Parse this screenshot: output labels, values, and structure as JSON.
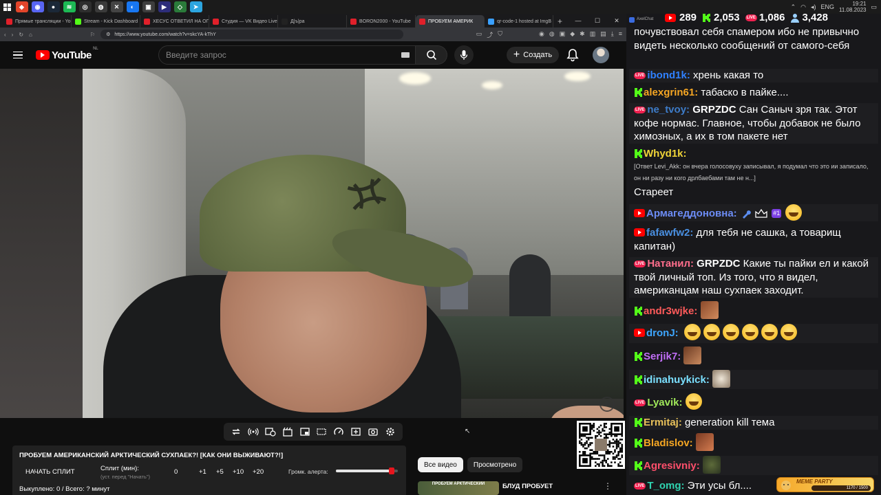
{
  "taskbar": {
    "tray_lang": "ENG",
    "time": "19:21",
    "date": "11.08.2023"
  },
  "browser": {
    "tabs": [
      {
        "label": "Прямые трансляции - YouT",
        "fav": "#e0202a"
      },
      {
        "label": "Stream - Kick Dashboard",
        "fav": "#53fc18"
      },
      {
        "label": "ХЕСУС ОТВЕТИЛ НА ОПРАВ",
        "fav": "#e0202a"
      },
      {
        "label": "Студия — VK Видео Live",
        "fav": "#e0202a"
      },
      {
        "label": "Д|ъ|ра",
        "fav": "#222222"
      },
      {
        "label": "BORON2000 - YouTube",
        "fav": "#e0202a"
      },
      {
        "label": "ПРОБУЕМ АМЕРИК",
        "fav": "#e0202a"
      },
      {
        "label": "qr-code-1 hosted at ImgB",
        "fav": "#3aa0ff"
      }
    ],
    "url": "https://www.youtube.com/watch?v=skcYA-kThY"
  },
  "youtube": {
    "logo_text": "YouTube",
    "region": "NL",
    "search_placeholder": "Введите запрос",
    "create_label": "Создать"
  },
  "panel": {
    "title": "ПРОБУЕМ АМЕРИКАНСКИЙ АРКТИЧЕСКИЙ СУХПАЕК?! [КАК ОНИ ВЫЖИВАЮТ?!]",
    "start_split": "НАЧАТЬ СПЛИТ",
    "split_label": "Сплит (мин):",
    "split_hint": "(уст. перед \"Начать\")",
    "split_value": "0",
    "increments": [
      "+1",
      "+5",
      "+10",
      "+20"
    ],
    "volume_label": "Громк. алерта:",
    "volume_level": 0.9,
    "stat_line": "Выкуплено: 0 / Всего: ? минут"
  },
  "chips": {
    "all_videos": "Все видео",
    "watched": "Просмотрено"
  },
  "recommendation": {
    "thumb_text": "ПРОБУЕМ АРКТИЧЕСКИЙ",
    "title": "БЛУД ПРОБУЕТ"
  },
  "chat": {
    "app_name": "AxelChat",
    "stats": {
      "youtube": "289",
      "kick": "2,053",
      "vk": "1,086",
      "total": "3,428"
    },
    "m0_text": "почувствовал себя спамером ибо не привычно видеть несколько сообщений от самого-себя",
    "m1_nick": "ibond1k:",
    "m1_text": " хрень какая то",
    "m2_nick": "alexgrin61:",
    "m2_text": " табаско в пайке....",
    "m3_nick": "ne_tvoy:",
    "m3_mention": " GRPZDC",
    "m3_text": " Сан Саныч зря так. Этот кофе нормас. Главное, чтобы добавок не было химозных, а их в том пакете нет",
    "m4_nick": "Whyd1k:",
    "m4_reply": "[Ответ Levi_Akk: он вчера голосовуху записывал, я подумал что это ии записало, он ни разу ни кого дрлбаебами там не н...]",
    "m4_text": "Стареет",
    "m5_nick": "Армагеддоновна:",
    "m5_badge": "#1",
    "m6_nick": "fafawfw2:",
    "m6_text": " для тебя не сашка, а товарищ капитан)",
    "m7_nick": "Натанил:",
    "m7_mention": " GRPZDC",
    "m7_text": " Какие ты пайки ел и какой твой личный топ. Из того, что я видел, американцам наш сухпаек заходит.",
    "m8_nick": "andr3wjke:",
    "m9_nick": "dronJ:",
    "m10_nick": "Serjik7:",
    "m11_nick": "idinahuykick:",
    "m12_nick": "Lyavik:",
    "m13_nick": "Ermitaj:",
    "m13_text": " generation kill тема",
    "m14_nick": "Bladislov:",
    "m15_nick": "Agresivniy:",
    "m16_nick": "T_omg:",
    "m16_text": " Эти усы бл....",
    "colors": {
      "kick": "#53fc18",
      "youtube": "#ff0000",
      "vk_live": "#f0204f"
    }
  },
  "meme_party": {
    "label": "MEME PARTY",
    "progress": "1170 / 1500"
  }
}
